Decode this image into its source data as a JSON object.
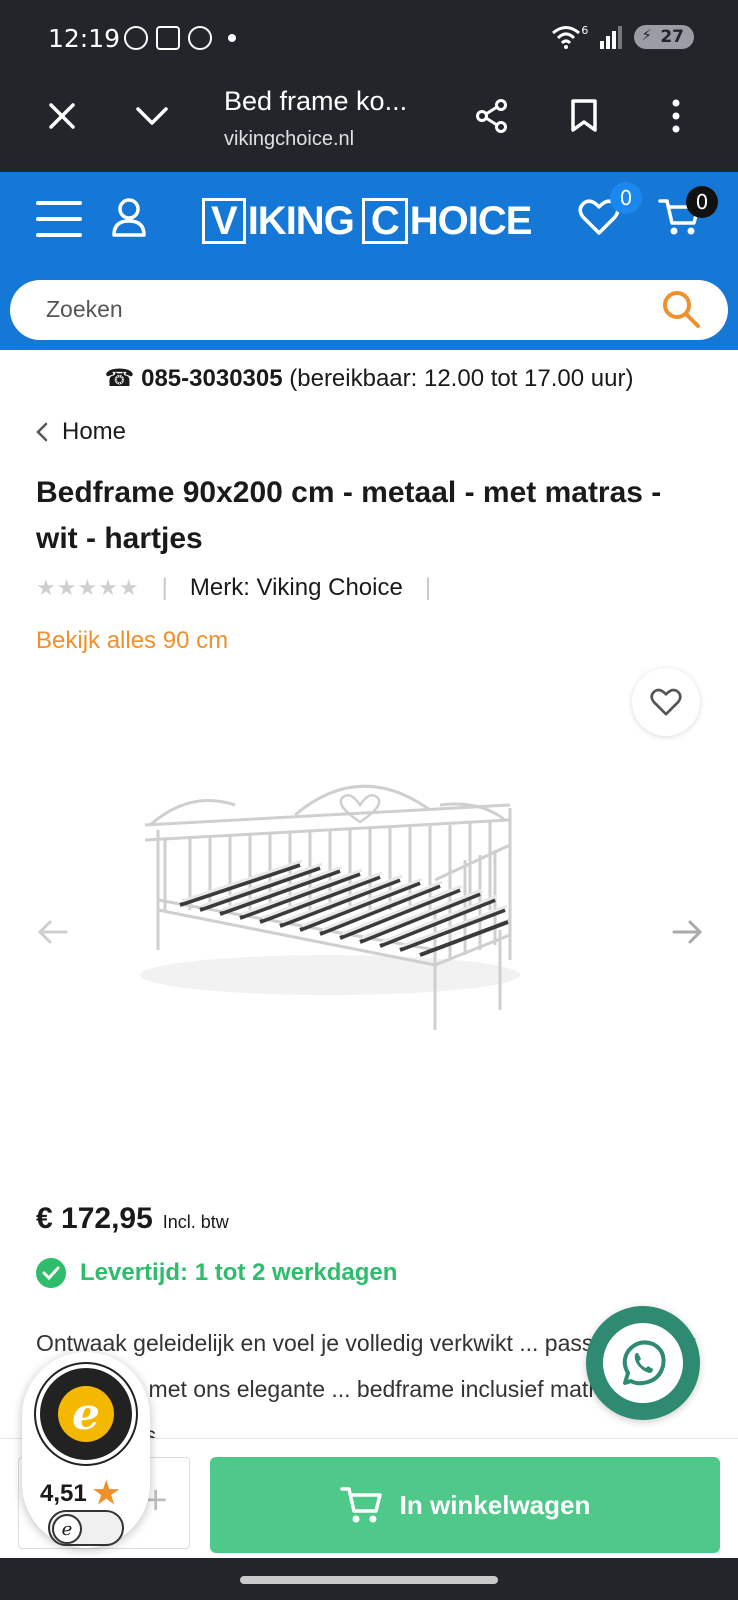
{
  "status": {
    "time": "12:19",
    "battery": "27",
    "net_badge": "6"
  },
  "browser": {
    "title": "Bed frame ko...",
    "url": "vikingchoice.nl"
  },
  "header": {
    "logo_v": "V",
    "logo_mid": "IKING",
    "logo_c": "C",
    "logo_end": "HOICE",
    "wishlist_count": "0",
    "cart_count": "0"
  },
  "search": {
    "placeholder": "Zoeken"
  },
  "contact": {
    "phone_icon": "☎",
    "phone": "085-3030305",
    "hours": "(bereikbaar: 12.00 tot 17.00 uur)"
  },
  "breadcrumb": {
    "label": "Home"
  },
  "product": {
    "title": "Bedframe 90x200 cm - metaal - met matras - wit - hartjes",
    "stars": "★★★★★",
    "rating": 0,
    "brand": "Merk: Viking Choice",
    "view_all": "Bekijk alles 90 cm",
    "price": "€ 172,95",
    "price_note": "Incl. btw",
    "delivery": "Levertijd: 1 tot 2 werkdagen",
    "description": "Ontwaak geleidelijk en voel je volledig verkwikt ... passende start van je dag met ons elegante ... bedframe inclusief matras. Dit bedframe is"
  },
  "cart_button": {
    "label": "In winkelwagen"
  },
  "qty": {
    "plus": "+"
  },
  "trusted_shops": {
    "score": "4,51",
    "star": "★",
    "seal_letter": "e",
    "toggle_letter": "e"
  },
  "icons": {
    "close": "close-icon",
    "chevron": "chevron-down-icon",
    "share": "share-icon",
    "bookmark": "bookmark-icon",
    "menu": "more-vert-icon",
    "hamburger": "hamburger-icon",
    "account": "user-icon",
    "heart": "heart-icon",
    "cart": "cart-icon",
    "search": "search-icon",
    "whatsapp": "whatsapp-icon"
  },
  "colors": {
    "brand_blue": "#1577d6",
    "accent_orange": "#f0902b",
    "green": "#2ebd6b",
    "cta_green": "#4ec98a"
  }
}
